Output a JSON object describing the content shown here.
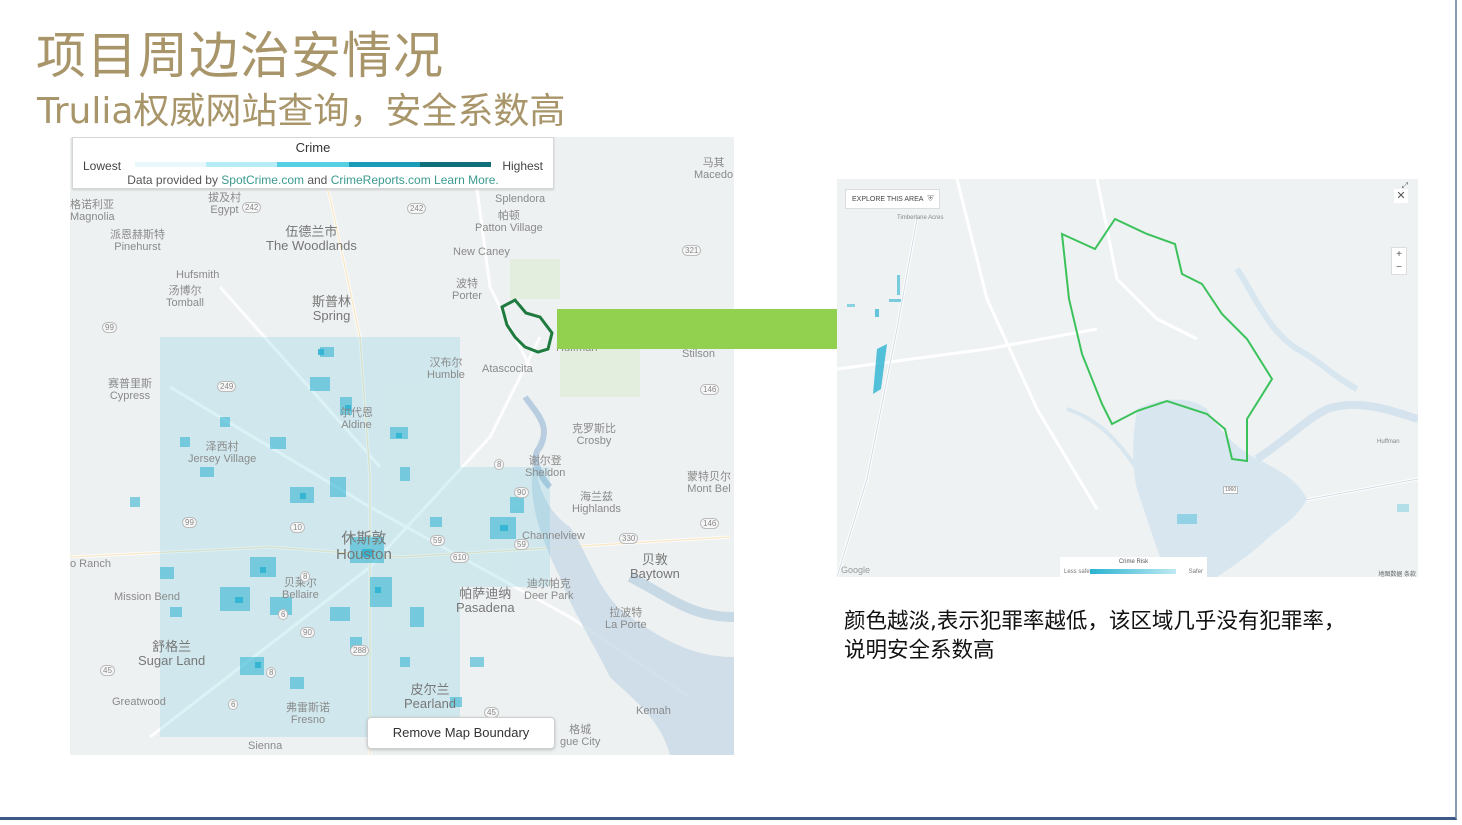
{
  "slide": {
    "title": "项目周边治安情况",
    "subtitle": "Trulia权威网站查询，安全系数高",
    "description_line1": "颜色越淡,表示犯罪率越低，该区域几乎没有犯罪率，",
    "description_line2": "说明安全系数高"
  },
  "left_map": {
    "legend": {
      "title": "Crime",
      "lowest": "Lowest",
      "highest": "Highest",
      "source_prefix": "Data provided by ",
      "source_spotcrime": "SpotCrime.com",
      "source_and": " and ",
      "source_crimereports": "CrimeReports.com",
      "learn_more": " Learn More.",
      "colors": [
        "#e8f8fb",
        "#b6ecf6",
        "#56cfe3",
        "#1a9bb8",
        "#0f6f7a"
      ]
    },
    "remove_boundary_button": "Remove Map Boundary",
    "places": [
      {
        "zh": "拔及村",
        "en": "Egypt"
      },
      {
        "zh": "格诺利亚",
        "en": "Magnolia"
      },
      {
        "zh": "派恩赫斯特",
        "en": "Pinehurst"
      },
      {
        "zh": "伍德兰市",
        "en": "The Woodlands"
      },
      {
        "zh": "帕顿",
        "en": "Patton Village"
      },
      {
        "zh": "",
        "en": "Splendora"
      },
      {
        "zh": "",
        "en": "New Caney"
      },
      {
        "zh": "",
        "en": "Hufsmith"
      },
      {
        "zh": "汤博尔",
        "en": "Tomball"
      },
      {
        "zh": "斯普林",
        "en": "Spring"
      },
      {
        "zh": "波特",
        "en": "Porter"
      },
      {
        "zh": "马其",
        "en": "Macedo"
      },
      {
        "zh": "",
        "en": "Huffman"
      },
      {
        "zh": "",
        "en": "Stilson"
      },
      {
        "zh": "汉布尔",
        "en": "Humble"
      },
      {
        "zh": "",
        "en": "Atascocita"
      },
      {
        "zh": "赛普里斯",
        "en": "Cypress"
      },
      {
        "zh": "尔代恩",
        "en": "Aldine"
      },
      {
        "zh": "克罗斯比",
        "en": "Crosby"
      },
      {
        "zh": "泽西村",
        "en": "Jersey Village"
      },
      {
        "zh": "谢尔登",
        "en": "Sheldon"
      },
      {
        "zh": "蒙特贝尔",
        "en": "Mont Bel"
      },
      {
        "zh": "海兰兹",
        "en": "Highlands"
      },
      {
        "zh": "休斯敦",
        "en": "Houston"
      },
      {
        "zh": "",
        "en": "Channelview"
      },
      {
        "zh": "贝敦",
        "en": "Baytown"
      },
      {
        "zh": "",
        "en": "o Ranch"
      },
      {
        "zh": "贝莱尔",
        "en": "Bellaire"
      },
      {
        "zh": "",
        "en": "Mission Bend"
      },
      {
        "zh": "迪尔帕克",
        "en": "Deer Park"
      },
      {
        "zh": "帕萨迪纳",
        "en": "Pasadena"
      },
      {
        "zh": "拉波特",
        "en": "La Porte"
      },
      {
        "zh": "舒格兰",
        "en": "Sugar Land"
      },
      {
        "zh": "",
        "en": "Greatwood"
      },
      {
        "zh": "弗雷斯诺",
        "en": "Fresno"
      },
      {
        "zh": "皮尔兰",
        "en": "Pearland"
      },
      {
        "zh": "",
        "en": "Kemah"
      },
      {
        "zh": "",
        "en": "Sienna"
      },
      {
        "zh": "格城",
        "en": "gue City"
      }
    ],
    "route_shields": [
      "242",
      "242",
      "321",
      "99",
      "249",
      "146",
      "8",
      "90",
      "146",
      "330",
      "59",
      "610",
      "10",
      "8",
      "90",
      "288",
      "6",
      "59",
      "45",
      "99",
      "6",
      "8",
      "45"
    ]
  },
  "right_map": {
    "explore_button": "EXPLORE THIS AREA",
    "close_icon": "close-icon",
    "zoom_in": "+",
    "zoom_out": "−",
    "place_labels": [
      "Timberlane Acres",
      "Huffman"
    ],
    "route_shields": [
      "1960"
    ],
    "risk_legend": {
      "title": "Crime Risk",
      "less_safe": "Less safe",
      "safer": "Safer"
    },
    "google_logo": "Google",
    "map_data_text": "地图数据  条款"
  },
  "colors": {
    "title_gold": "#a8956a",
    "arrow_green": "#92d050",
    "boundary_dark_green": "#1f7a3e",
    "boundary_green": "#3cc25b",
    "crime_cyan": "#2ab3d1"
  }
}
